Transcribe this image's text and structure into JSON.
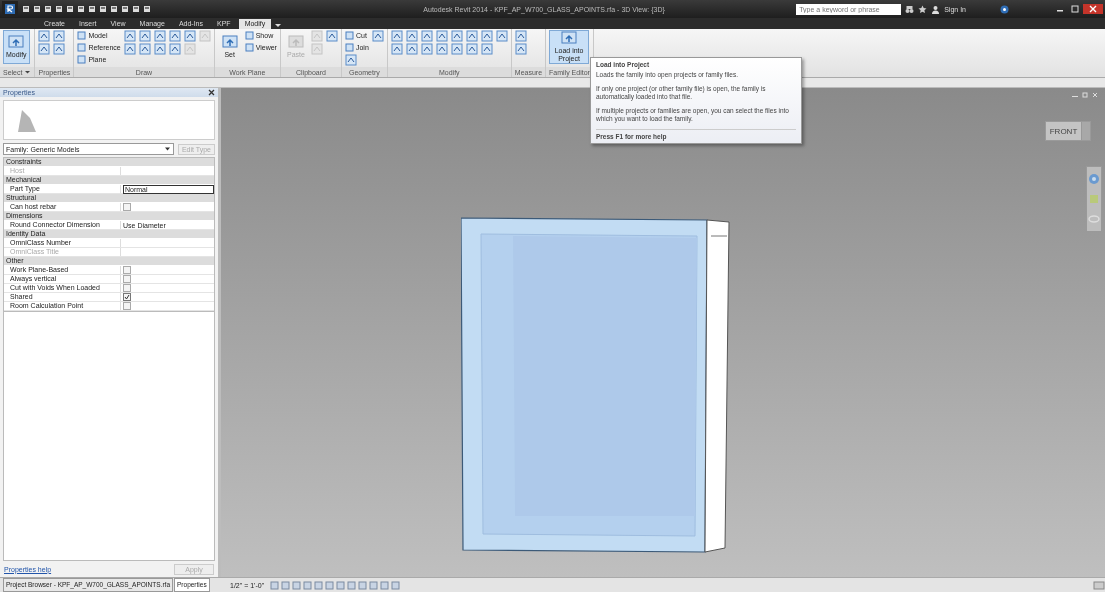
{
  "title_bar": {
    "title": "Autodesk Revit 2014 - KPF_AP_W700_GLASS_APOINTS.rfa - 3D View: {3D}",
    "search": {
      "placeholder": "Type a keyword or phrase"
    },
    "sign_in": "Sign In"
  },
  "ribbon_tabs": [
    {
      "label": "Create",
      "selected": false
    },
    {
      "label": "Insert",
      "selected": false
    },
    {
      "label": "View",
      "selected": false
    },
    {
      "label": "Manage",
      "selected": false
    },
    {
      "label": "Add-Ins",
      "selected": false
    },
    {
      "label": "KPF",
      "selected": false
    },
    {
      "label": "Modify",
      "selected": true
    }
  ],
  "ribbon_panels": [
    {
      "label": "Select",
      "dropdown": true,
      "tools": [
        {
          "kind": "large",
          "label": "Modify",
          "highlighted": true,
          "disabled": false
        }
      ]
    },
    {
      "label": "Properties",
      "tools": [
        {
          "kind": "icon",
          "disabled": false
        },
        {
          "kind": "icon",
          "disabled": false
        },
        {
          "kind": "icon",
          "disabled": false
        },
        {
          "kind": "icon",
          "disabled": false
        }
      ]
    },
    {
      "label": "Draw",
      "tools": [
        {
          "kind": "small",
          "label": "Model",
          "disabled": false
        },
        {
          "kind": "small",
          "label": "Reference",
          "disabled": false
        },
        {
          "kind": "small",
          "label": "Plane",
          "disabled": false
        },
        {
          "kind": "icon",
          "disabled": false
        },
        {
          "kind": "icon",
          "disabled": false
        },
        {
          "kind": "icon",
          "disabled": false
        },
        {
          "kind": "icon",
          "disabled": false
        },
        {
          "kind": "icon",
          "disabled": false
        },
        {
          "kind": "icon",
          "disabled": false
        },
        {
          "kind": "icon",
          "disabled": false
        },
        {
          "kind": "icon",
          "disabled": false
        },
        {
          "kind": "icon",
          "disabled": false
        },
        {
          "kind": "icon",
          "disabled": true
        },
        {
          "kind": "icon",
          "disabled": true
        }
      ]
    },
    {
      "label": "Work Plane",
      "tools": [
        {
          "kind": "large",
          "label": "Set",
          "highlighted": false,
          "disabled": false
        },
        {
          "kind": "small",
          "label": "Show",
          "disabled": false
        },
        {
          "kind": "small",
          "label": "Viewer",
          "disabled": false
        }
      ]
    },
    {
      "label": "Clipboard",
      "tools": [
        {
          "kind": "large",
          "label": "Paste",
          "highlighted": false,
          "disabled": true
        },
        {
          "kind": "icon",
          "disabled": true
        },
        {
          "kind": "icon",
          "disabled": true
        },
        {
          "kind": "icon",
          "disabled": false
        }
      ]
    },
    {
      "label": "Geometry",
      "tools": [
        {
          "kind": "small",
          "label": "Cut",
          "disabled": false
        },
        {
          "kind": "small",
          "label": "Join",
          "disabled": false
        },
        {
          "kind": "icon",
          "disabled": false
        },
        {
          "kind": "icon",
          "disabled": false
        }
      ]
    },
    {
      "label": "Modify",
      "tools": [
        {
          "kind": "icon",
          "disabled": false
        },
        {
          "kind": "icon",
          "disabled": false
        },
        {
          "kind": "icon",
          "disabled": false
        },
        {
          "kind": "icon",
          "disabled": false
        },
        {
          "kind": "icon",
          "disabled": false
        },
        {
          "kind": "icon",
          "disabled": false
        },
        {
          "kind": "icon",
          "disabled": false
        },
        {
          "kind": "icon",
          "disabled": false
        },
        {
          "kind": "icon",
          "disabled": false
        },
        {
          "kind": "icon",
          "disabled": false
        },
        {
          "kind": "icon",
          "disabled": false
        },
        {
          "kind": "icon",
          "disabled": false
        },
        {
          "kind": "icon",
          "disabled": false
        },
        {
          "kind": "icon",
          "disabled": false
        },
        {
          "kind": "icon",
          "disabled": false
        }
      ]
    },
    {
      "label": "Measure",
      "tools": [
        {
          "kind": "icon",
          "disabled": false
        },
        {
          "kind": "icon",
          "disabled": false
        }
      ]
    },
    {
      "label": "Family Editor",
      "tools": [
        {
          "kind": "large",
          "label": "Load into Project",
          "highlighted": true,
          "disabled": false
        }
      ]
    }
  ],
  "tooltip": {
    "title": "Load into Project",
    "paragraphs": [
      "Loads the family into open projects or family files.",
      "If only one project (or other family file) is open, the family is automatically loaded into that file.",
      "If multiple projects or families are open, you can select the files into which you want to load the family."
    ],
    "help": "Press F1 for more help"
  },
  "properties": {
    "title": "Properties",
    "type_selector": "Family: Generic Models",
    "edit_type": "Edit Type",
    "groups": [
      {
        "name": "Constraints",
        "rows": [
          {
            "kind": "text",
            "name": "Host",
            "disabled": true
          }
        ]
      },
      {
        "name": "Mechanical",
        "rows": [
          {
            "kind": "field",
            "name": "Part Type",
            "value": "Normal",
            "disabled": false
          }
        ]
      },
      {
        "name": "Structural",
        "rows": [
          {
            "kind": "checkbox",
            "name": "Can host rebar",
            "checked": false,
            "disabled": false
          }
        ]
      },
      {
        "name": "Dimensions",
        "rows": [
          {
            "kind": "text",
            "name": "Round Connector Dimension",
            "value": "Use Diameter",
            "disabled": false
          }
        ]
      },
      {
        "name": "Identity Data",
        "rows": [
          {
            "kind": "text",
            "name": "OmniClass Number",
            "disabled": false
          },
          {
            "kind": "text",
            "name": "OmniClass Title",
            "disabled": true
          }
        ]
      },
      {
        "name": "Other",
        "rows": [
          {
            "kind": "checkbox",
            "name": "Work Plane-Based",
            "checked": false,
            "disabled": false
          },
          {
            "kind": "checkbox",
            "name": "Always vertical",
            "checked": false,
            "disabled": false
          },
          {
            "kind": "checkbox",
            "name": "Cut with Voids When Loaded",
            "checked": false,
            "disabled": false
          },
          {
            "kind": "checkbox",
            "name": "Shared",
            "checked": true,
            "disabled": false
          },
          {
            "kind": "checkbox",
            "name": "Room Calculation Point",
            "checked": false,
            "disabled": false
          }
        ]
      }
    ],
    "help_link": "Properties help",
    "apply": "Apply"
  },
  "bottom_tabs": [
    {
      "label": "Project Browser - KPF_AP_W700_GLASS_APOINTS.rfa",
      "selected": false
    },
    {
      "label": "Properties",
      "selected": true
    }
  ],
  "view_bar": {
    "scale": "1/2\" = 1'-0\""
  },
  "viewcube": {
    "face": "FRONT"
  }
}
